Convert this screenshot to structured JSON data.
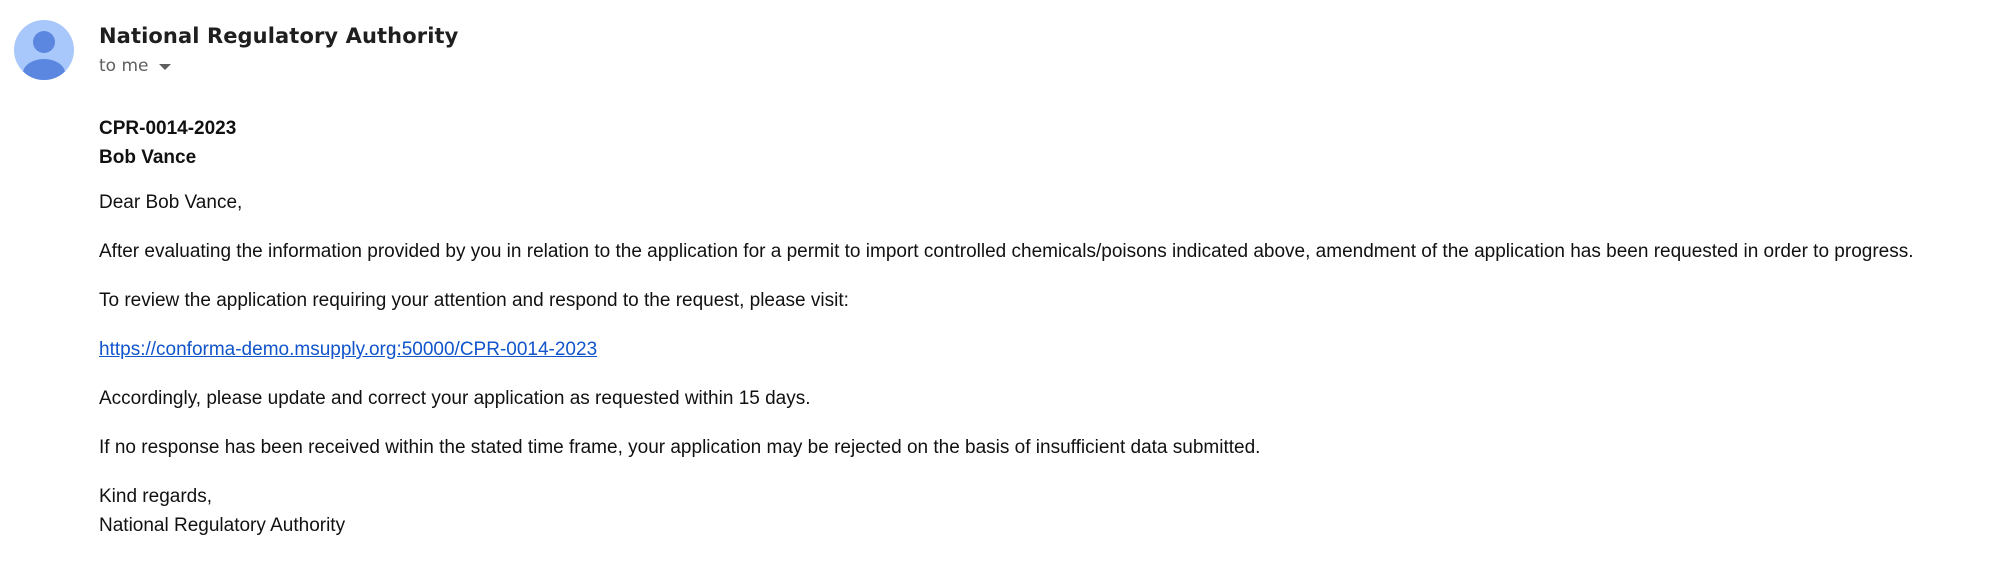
{
  "email": {
    "sender_name": "National Regulatory Authority",
    "recipient_label": "to me",
    "reference": "CPR-0014-2023",
    "recipient_name": "Bob Vance",
    "greeting": "Dear Bob Vance,",
    "paragraph_1": "After evaluating the information provided by you in relation to the application for a permit to import controlled chemicals/poisons indicated above, amendment of the application has been requested in order to progress.",
    "paragraph_2": "To review the application requiring your attention and respond to the request, please visit:",
    "link_text": "https://conforma-demo.msupply.org:50000/CPR-0014-2023",
    "paragraph_3": "Accordingly, please update and correct your application as requested within 15 days.",
    "paragraph_4": "If no response has been received within the stated time frame, your application may be rejected on the basis of insufficient data submitted.",
    "closing": "Kind regards,",
    "signature": "National Regulatory Authority"
  },
  "icons": {
    "avatar": "person-icon",
    "recipient_toggle": "caret-down-icon"
  },
  "colors": {
    "avatar_bg": "#a8c7fa",
    "avatar_figure": "#5b87e0",
    "link": "#1155cc",
    "secondary_text": "#5e5e5e"
  }
}
